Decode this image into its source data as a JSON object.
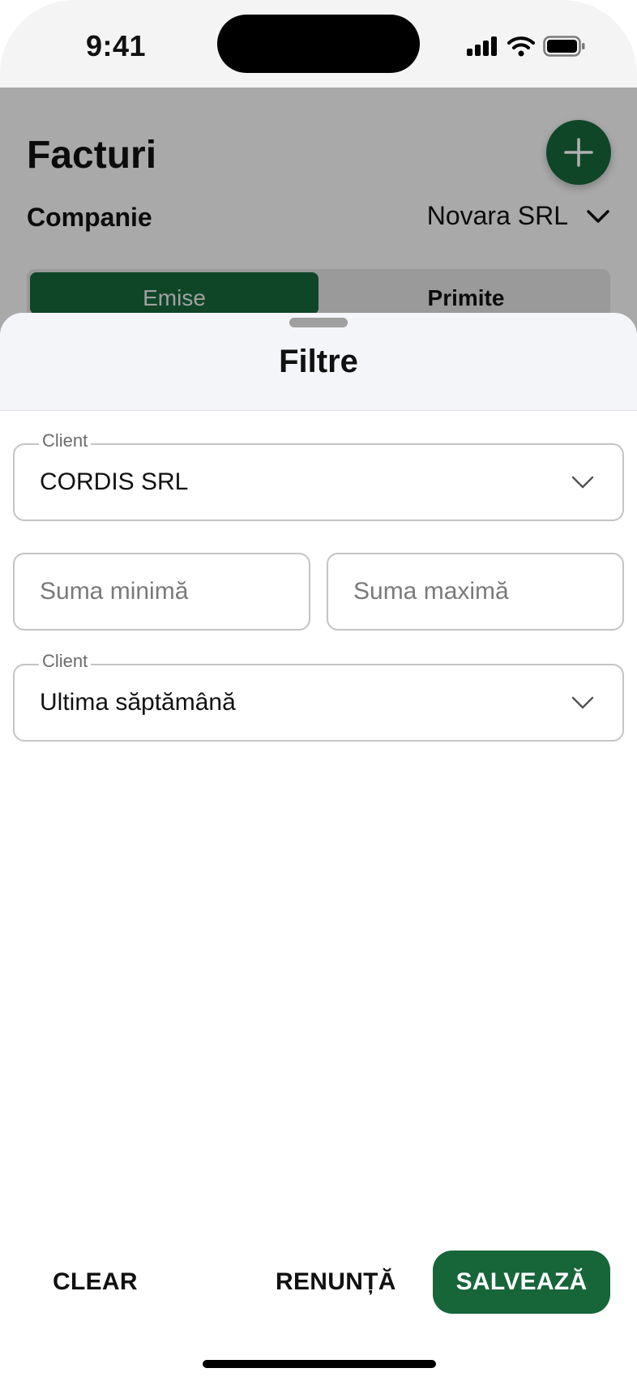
{
  "status_bar": {
    "time": "9:41",
    "icons": [
      "cellular-signal-icon",
      "wifi-icon",
      "battery-icon"
    ]
  },
  "background_screen": {
    "title": "Facturi",
    "add_icon": "plus-icon",
    "company_label": "Companie",
    "company_value": "Novara SRL",
    "tabs": [
      {
        "label": "Emise",
        "active": true
      },
      {
        "label": "Primite",
        "active": false
      }
    ]
  },
  "sheet": {
    "title": "Filtre",
    "client_field": {
      "label": "Client",
      "value": "CORDIS SRL"
    },
    "min_amount": {
      "placeholder": "Suma minimă"
    },
    "max_amount": {
      "placeholder": "Suma maximă"
    },
    "period_field": {
      "label": "Client",
      "value": "Ultima săptămână"
    },
    "actions": {
      "clear": "CLEAR",
      "cancel": "RENUNȚĂ",
      "save": "SALVEAZĂ"
    }
  },
  "colors": {
    "accent_green": "#17663a",
    "overlay": "rgba(0,0,0,0.31)",
    "sheet_header_bg": "#f4f5f9",
    "field_border": "#c4c4c4"
  }
}
